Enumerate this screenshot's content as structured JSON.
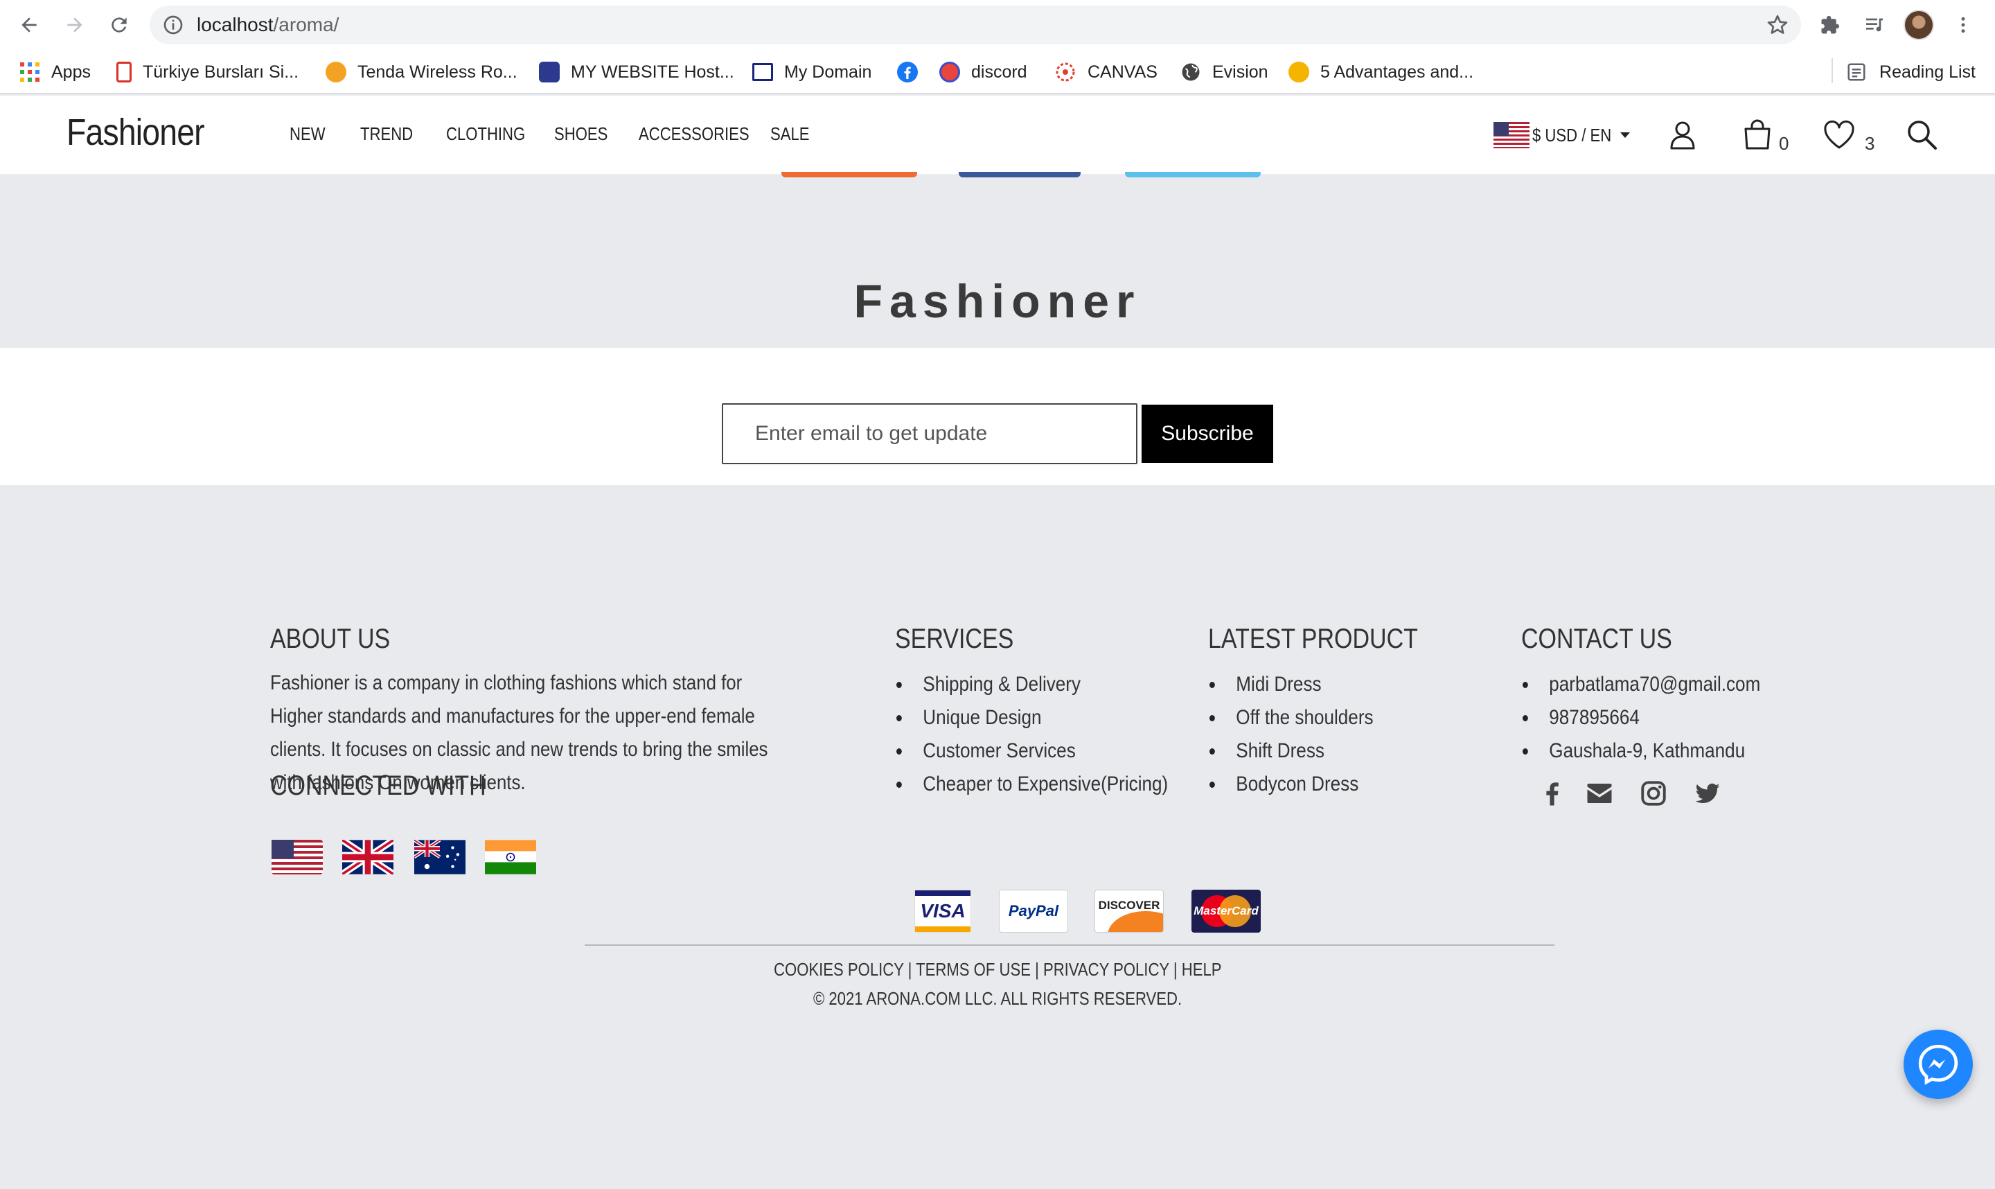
{
  "browser": {
    "url_host": "localhost",
    "url_path": "/aroma/",
    "bookmarks": [
      {
        "label": "Apps",
        "icon": "apps-grid-icon",
        "color": "#ea4335"
      },
      {
        "label": "Türkiye Bursları Si...",
        "icon": "turkiye-burslari-icon",
        "color": "#d93025"
      },
      {
        "label": "Tenda Wireless Ro...",
        "icon": "tenda-icon",
        "color": "#f4a223"
      },
      {
        "label": "MY WEBSITE Host...",
        "icon": "hosting-icon",
        "color": "#2b3a8c"
      },
      {
        "label": "My Domain",
        "icon": "domain-icon",
        "color": "#1a237e"
      },
      {
        "label": "",
        "icon": "facebook-icon",
        "color": "#1877f2"
      },
      {
        "label": "discord",
        "icon": "discord-icon",
        "color": "#e8453c"
      },
      {
        "label": "CANVAS",
        "icon": "canvas-icon",
        "color": "#e13f2b"
      },
      {
        "label": "Evision",
        "icon": "globe-icon",
        "color": "#444444"
      },
      {
        "label": "5 Advantages and...",
        "icon": "people-icon",
        "color": "#f4b400"
      }
    ],
    "reading_list": "Reading List"
  },
  "header": {
    "logo": "Fashioner",
    "menu": [
      "NEW",
      "TREND",
      "CLOTHING",
      "SHOES",
      "ACCESSORIES",
      "SALE"
    ],
    "currency": "$ USD / EN",
    "cart_count": "0",
    "wishlist_count": "3"
  },
  "brand": {
    "title": "Fashioner"
  },
  "newsletter": {
    "placeholder": "Enter email to get update",
    "button": "Subscribe"
  },
  "footer": {
    "about": {
      "heading": "ABOUT US",
      "text": "Fashioner is a company in clothing fashions which stand for Higher standards and manufactures for the upper-end female clients. It focuses on classic and new trends to bring the smiles with fashions On women clients."
    },
    "connected": {
      "heading": "CONNECTED WITH",
      "flags": [
        "us-flag-icon",
        "uk-flag-icon",
        "australia-flag-icon",
        "india-flag-icon"
      ]
    },
    "services": {
      "heading": "SERVICES",
      "items": [
        "Shipping & Delivery",
        "Unique Design",
        "Customer Services",
        "Cheaper to Expensive(Pricing)"
      ]
    },
    "latest": {
      "heading": "LATEST PRODUCT",
      "items": [
        "Midi Dress",
        "Off the shoulders",
        "Shift Dress",
        "Bodycon Dress"
      ]
    },
    "contact": {
      "heading": "CONTACT US",
      "items": [
        "parbatlama70@gmail.com",
        "987895664",
        "Gaushala-9, Kathmandu"
      ],
      "social": [
        "facebook-icon",
        "envelope-icon",
        "instagram-icon",
        "twitter-icon"
      ]
    },
    "payments": [
      "VISA",
      "PayPal",
      "DISCOVER",
      "MasterCard"
    ],
    "legal_links": [
      "COOKIES POLICY",
      "TERMS OF USE",
      "PRIVACY POLICY",
      "HELP"
    ],
    "copyright": "© 2021 ARONA.COM LLC. ALL RIGHTS RESERVED."
  },
  "colors": {
    "page_bg": "#e8eaee",
    "subscribe_bg": "#000000",
    "messenger": "#1e87ff"
  }
}
